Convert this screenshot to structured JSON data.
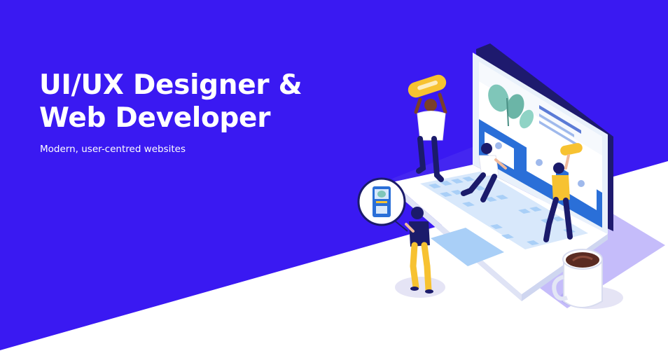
{
  "hero": {
    "headline_line1": "UI/UX Designer &",
    "headline_line2": "Web Developer",
    "tagline": "Modern, user-centred websites"
  },
  "colors": {
    "background_blue": "#3a19f2",
    "white": "#ffffff",
    "accent_yellow": "#f7c231",
    "navy": "#1b1b6b",
    "light_blue": "#a9cff7",
    "teal": "#7fc6b9"
  },
  "illustration": {
    "icons": [
      "laptop-illustration",
      "coffee-mug-illustration",
      "phone-bubble-illustration"
    ]
  }
}
